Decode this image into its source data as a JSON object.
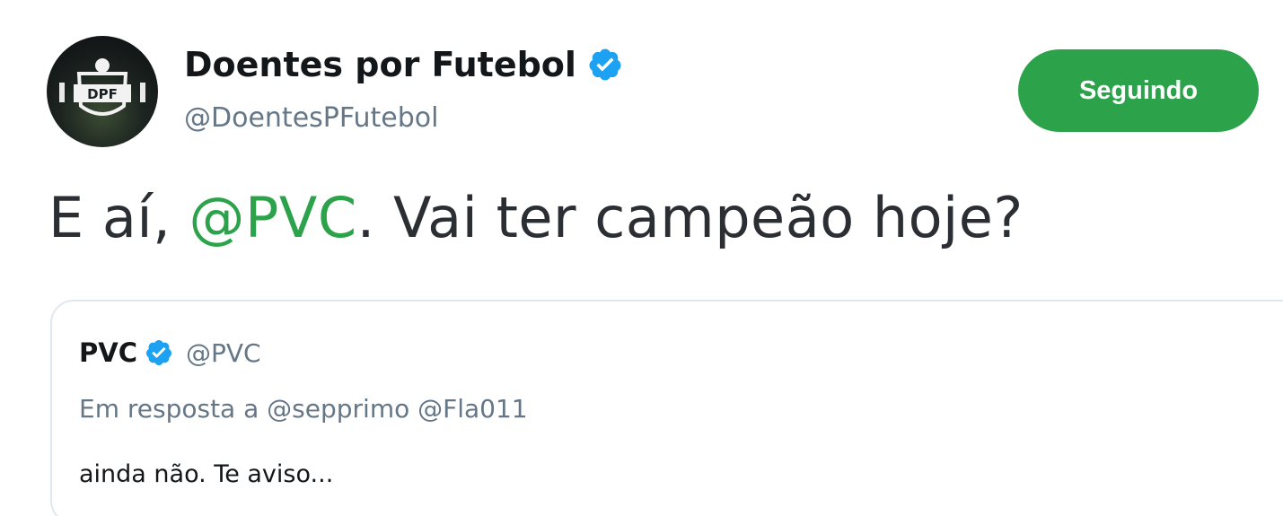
{
  "author": {
    "display_name": "Doentes por Futebol",
    "handle": "@DoentesPFutebol",
    "verified": true,
    "avatar_text": "DPF"
  },
  "follow_button": {
    "label": "Seguindo",
    "color": "#2ca24a"
  },
  "tweet": {
    "text_before": "E aí, ",
    "mention": "@PVC",
    "text_after": ". Vai ter campeão hoje?"
  },
  "quoted_tweet": {
    "display_name": "PVC",
    "handle": "@PVC",
    "verified": true,
    "reply_to": "Em resposta a @sepprimo @Fla011",
    "text": "ainda não. Te aviso..."
  },
  "colors": {
    "accent": "#2ca24a",
    "verified": "#1da1f2",
    "secondary_text": "#657786"
  },
  "icons": {
    "verified": "verified-badge-icon"
  }
}
